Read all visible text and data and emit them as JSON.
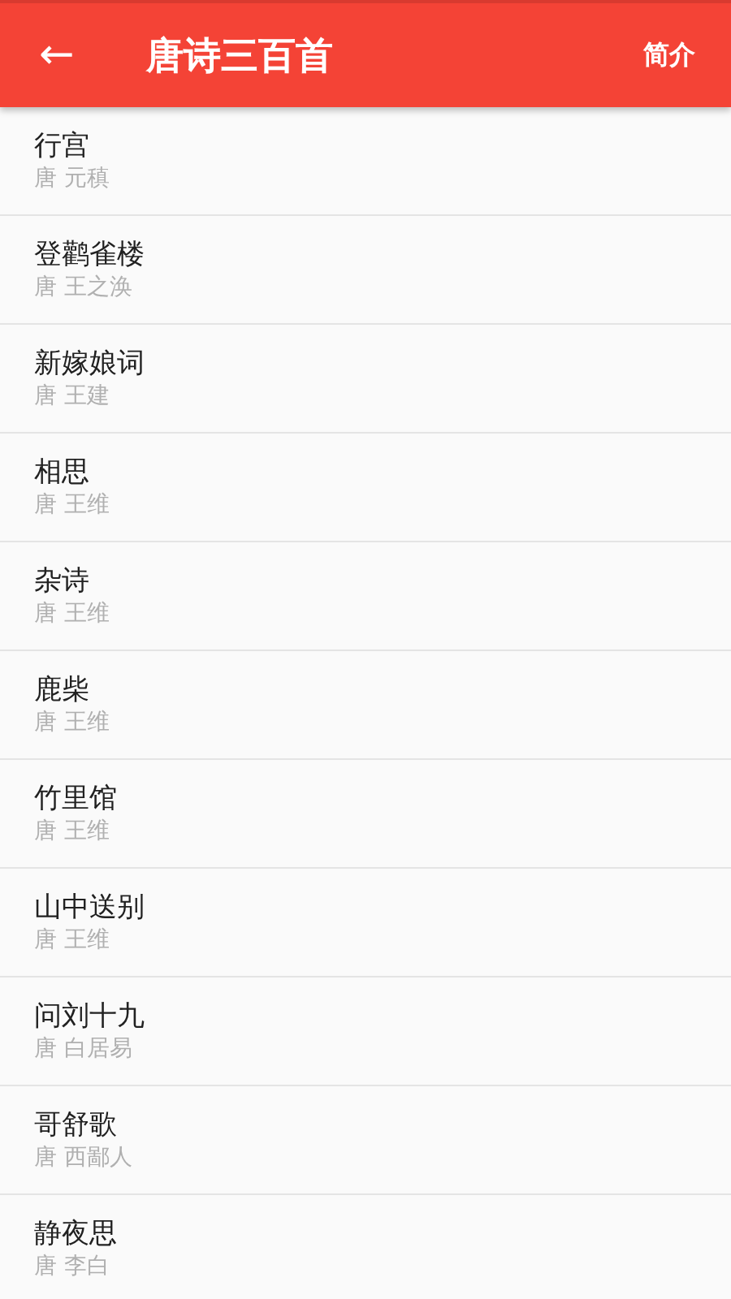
{
  "app_bar": {
    "back": "←",
    "title": "唐诗三百首",
    "action": "简介"
  },
  "poems": [
    {
      "title": "行宫",
      "author": "唐 元稹"
    },
    {
      "title": "登鹳雀楼",
      "author": "唐 王之涣"
    },
    {
      "title": "新嫁娘词",
      "author": "唐 王建"
    },
    {
      "title": "相思",
      "author": "唐 王维"
    },
    {
      "title": "杂诗",
      "author": "唐 王维"
    },
    {
      "title": "鹿柴",
      "author": "唐 王维"
    },
    {
      "title": "竹里馆",
      "author": "唐 王维"
    },
    {
      "title": "山中送别",
      "author": "唐 王维"
    },
    {
      "title": "问刘十九",
      "author": "唐 白居易"
    },
    {
      "title": "哥舒歌",
      "author": "唐 西鄙人"
    },
    {
      "title": "静夜思",
      "author": "唐 李白"
    }
  ]
}
